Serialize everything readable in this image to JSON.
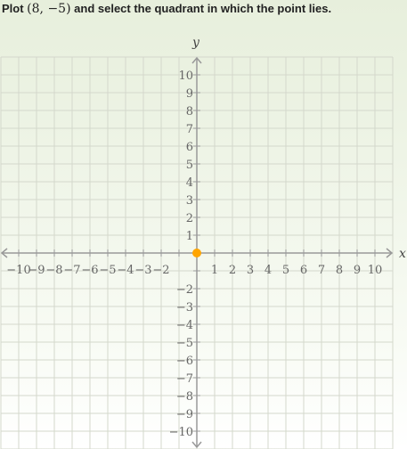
{
  "prompt": {
    "before": "Plot ",
    "point": "(8, −5)",
    "after": " and select the quadrant in which the point lies."
  },
  "graph": {
    "x_axis_label": "x",
    "y_axis_label": "y",
    "x_range": [
      -10,
      10
    ],
    "y_range": [
      -10,
      10
    ],
    "step": 1,
    "x_tick_labels": [
      "−10",
      "−9",
      "−8",
      "−7",
      "−6",
      "−5",
      "−4",
      "−3",
      "−2",
      "",
      "",
      "1",
      "2",
      "3",
      "4",
      "5",
      "6",
      "7",
      "8",
      "9",
      "10"
    ],
    "y_tick_labels": [
      "10",
      "9",
      "8",
      "7",
      "6",
      "5",
      "4",
      "3",
      "2",
      "1",
      "",
      "",
      "−2",
      "−3",
      "−4",
      "−5",
      "−6",
      "−7",
      "−8",
      "−9",
      "−10"
    ],
    "movable_point": {
      "x": 0,
      "y": 0
    },
    "colors": {
      "grid": "#d4d8cc",
      "axis": "#999999",
      "point": "#ffa500"
    }
  }
}
